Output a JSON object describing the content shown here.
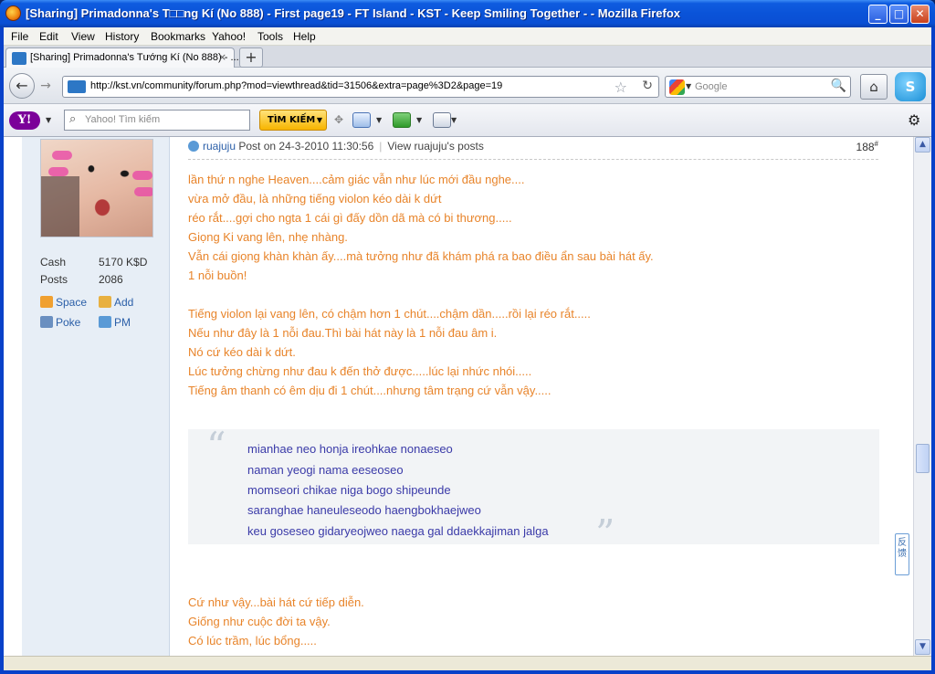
{
  "window": {
    "title": "[Sharing] Primadonna's T□□ng Kí (No 888) - First page19 - FT Island - KST - Keep Smiling Together - - Mozilla Firefox",
    "minimize": "_",
    "maximize": "□",
    "close": "✕"
  },
  "menu": [
    "File",
    "Edit",
    "View",
    "History",
    "Bookmarks",
    "Yahoo!",
    "Tools",
    "Help"
  ],
  "tab": {
    "title": "[Sharing] Primadonna's Tướng Kí (No 888) - ...",
    "close": "×",
    "new_tab": "+"
  },
  "nav": {
    "back": "←",
    "forward": "→",
    "url": "http://kst.vn/community/forum.php?mod=viewthread&tid=31506&extra=page%3D2&page=19",
    "star": "☆",
    "reload": "↻",
    "search_placeholder": "Google",
    "search_icon": "magnifier-icon",
    "home": "⌂",
    "skype": "S"
  },
  "yahoo_toolbar": {
    "logo": "Y!",
    "search_placeholder": "Yahoo! Tìm kiếm",
    "search_button": "TÌM KIẾM",
    "icons": [
      "mail-icon",
      "widget-icon",
      "bookmark-icon"
    ],
    "settings_icon": "gear-icon"
  },
  "sidebar": {
    "stats": [
      {
        "label": "Cash",
        "value": "5170 K$D"
      },
      {
        "label": "Posts",
        "value": "2086"
      }
    ],
    "links": [
      "Space",
      "Add",
      "Poke",
      "PM"
    ]
  },
  "post": {
    "author": "ruajuju",
    "posted_on": "Post on 24-3-2010 11:30:56",
    "view_posts": "View ruajuju's posts",
    "number": "188",
    "number_sup": "#",
    "lines_part1": [
      "lần thứ n nghe Heaven....cảm giác vẫn như lúc mới đầu nghe....",
      "vừa mở đầu, là những tiếng violon kéo dài k dứt",
      "réo rắt....gợi cho ngta 1 cái gì đấy dồn dã mà có bi thương.....",
      "Giọng Ki vang lên, nhẹ nhàng.",
      "Vẫn cái giọng khàn khàn ấy....mà tưởng như đã khám phá ra bao điều ẩn sau bài hát ấy.",
      "1 nỗi buồn!"
    ],
    "lines_part2": [
      "Tiếng violon lại vang lên, có chậm hơn 1 chút....chậm dần.....rồi lại réo rắt.....",
      "Nếu như đây là 1 nỗi đau.Thì bài hát này là 1 nỗi đau âm i.",
      "Nó cứ kéo dài k dứt.",
      "Lúc tưởng chừng như đau k đến thở được.....lúc lại nhức nhói.....",
      "Tiếng âm thanh có êm dịu đi 1 chút....nhưng tâm trạng cứ vẫn vậy....."
    ],
    "quote": [
      "mianhae neo honja ireohkae nonaeseo",
      "naman yeogi nama eeseoseo",
      "momseori chikae niga bogo shipeunde",
      "saranghae haneuleseodo haengbokhaejweo",
      "keu goseseo gidaryeojweo naega gal ddaekkajiman jalga"
    ],
    "quote_open": "“",
    "quote_close": "”",
    "lines_part3": [
      "Cứ như vậy...bài hát cứ tiếp diễn.",
      "Giống như cuộc đời ta vậy.",
      "Có lúc trầm, lúc bổng....."
    ]
  },
  "feedback_tab": "反馈",
  "colors": {
    "post_text": "#e8842a",
    "quote_text": "#3a3aa8",
    "link": "#2b5fa8",
    "titlebar": "#0a53d8"
  }
}
